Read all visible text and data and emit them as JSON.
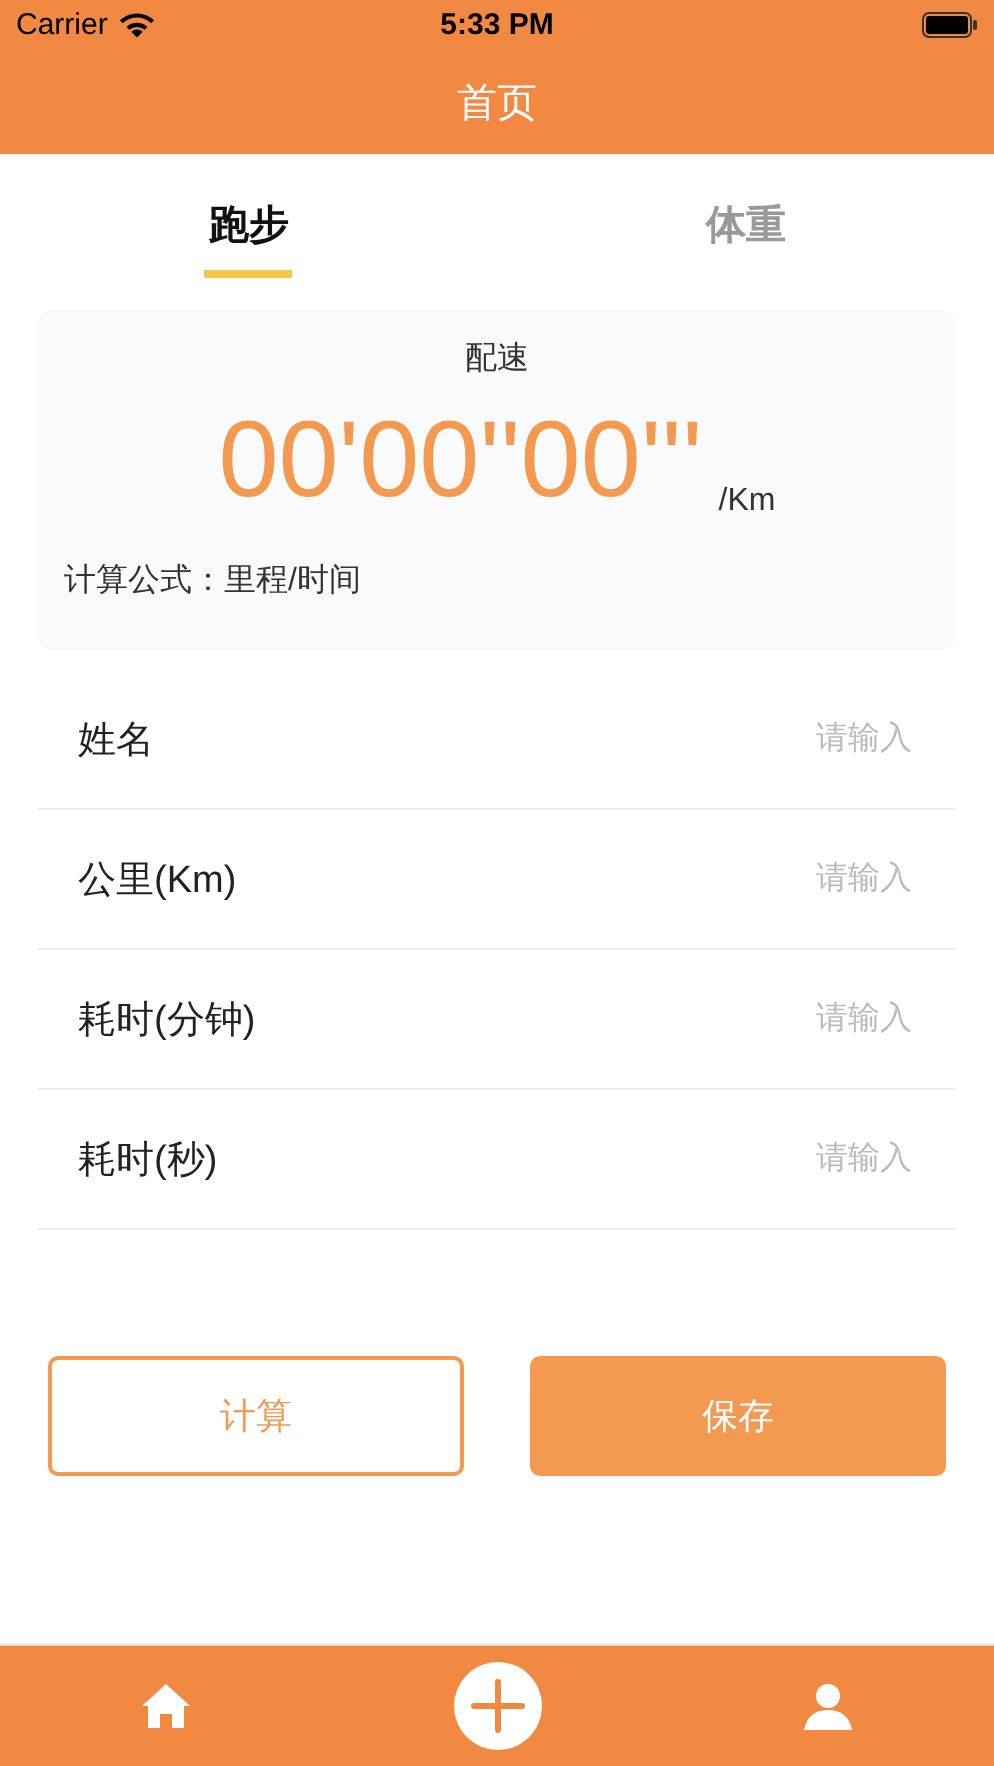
{
  "status_bar": {
    "carrier": "Carrier",
    "time": "5:33 PM"
  },
  "nav_bar": {
    "title": "首页"
  },
  "tabs": [
    {
      "label": "跑步",
      "selected": true
    },
    {
      "label": "体重",
      "selected": false
    }
  ],
  "pace_card": {
    "title": "配速",
    "value": "00'00''00'''",
    "unit": "/Km",
    "formula": "计算公式：里程/时间"
  },
  "fields": [
    {
      "label": "姓名",
      "placeholder": "请输入"
    },
    {
      "label": "公里(Km)",
      "placeholder": "请输入"
    },
    {
      "label": "耗时(分钟)",
      "placeholder": "请输入"
    },
    {
      "label": "耗时(秒)",
      "placeholder": "请输入"
    }
  ],
  "buttons": [
    {
      "label": "计算",
      "kind": "outline"
    },
    {
      "label": "保存",
      "kind": "filled"
    }
  ],
  "tab_bar": [
    {
      "kind": "home"
    },
    {
      "kind": "add"
    },
    {
      "kind": "profile"
    }
  ]
}
